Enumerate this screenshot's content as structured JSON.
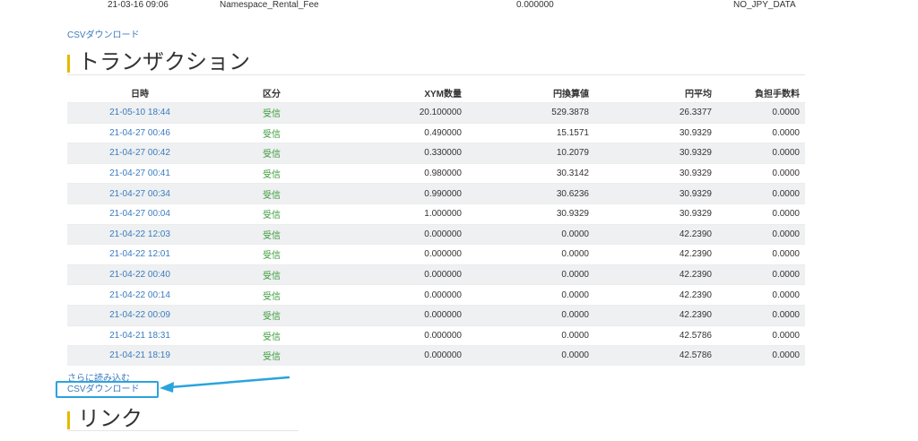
{
  "top_row": {
    "datetime": "21-03-16 09:06",
    "type": "Namespace_Rental_Fee",
    "amount": "0.000000",
    "jpy": "NO_JPY_DATA"
  },
  "csv_download_top": "CSVダウンロード",
  "transactions": {
    "title": "トランザクション",
    "headers": [
      "日時",
      "区分",
      "XYM数量",
      "円換算値",
      "円平均",
      "負担手数料"
    ],
    "rows": [
      [
        "21-05-10 18:44",
        "受信",
        "20.100000",
        "529.3878",
        "26.3377",
        "0.0000"
      ],
      [
        "21-04-27 00:46",
        "受信",
        "0.490000",
        "15.1571",
        "30.9329",
        "0.0000"
      ],
      [
        "21-04-27 00:42",
        "受信",
        "0.330000",
        "10.2079",
        "30.9329",
        "0.0000"
      ],
      [
        "21-04-27 00:41",
        "受信",
        "0.980000",
        "30.3142",
        "30.9329",
        "0.0000"
      ],
      [
        "21-04-27 00:34",
        "受信",
        "0.990000",
        "30.6236",
        "30.9329",
        "0.0000"
      ],
      [
        "21-04-27 00:04",
        "受信",
        "1.000000",
        "30.9329",
        "30.9329",
        "0.0000"
      ],
      [
        "21-04-22 12:03",
        "受信",
        "0.000000",
        "0.0000",
        "42.2390",
        "0.0000"
      ],
      [
        "21-04-22 12:01",
        "受信",
        "0.000000",
        "0.0000",
        "42.2390",
        "0.0000"
      ],
      [
        "21-04-22 00:40",
        "受信",
        "0.000000",
        "0.0000",
        "42.2390",
        "0.0000"
      ],
      [
        "21-04-22 00:14",
        "受信",
        "0.000000",
        "0.0000",
        "42.2390",
        "0.0000"
      ],
      [
        "21-04-22 00:09",
        "受信",
        "0.000000",
        "0.0000",
        "42.2390",
        "0.0000"
      ],
      [
        "21-04-21 18:31",
        "受信",
        "0.000000",
        "0.0000",
        "42.5786",
        "0.0000"
      ],
      [
        "21-04-21 18:19",
        "受信",
        "0.000000",
        "0.0000",
        "42.5786",
        "0.0000"
      ]
    ]
  },
  "load_more": "さらに読み込む",
  "csv_download_bottom": "CSVダウンロード",
  "links": {
    "title": "リンク"
  },
  "colors": {
    "link": "#3b7bbf",
    "direction_green": "#3a9a3a",
    "title_accent": "#e6b800",
    "highlight_box": "#2ba3dd"
  }
}
